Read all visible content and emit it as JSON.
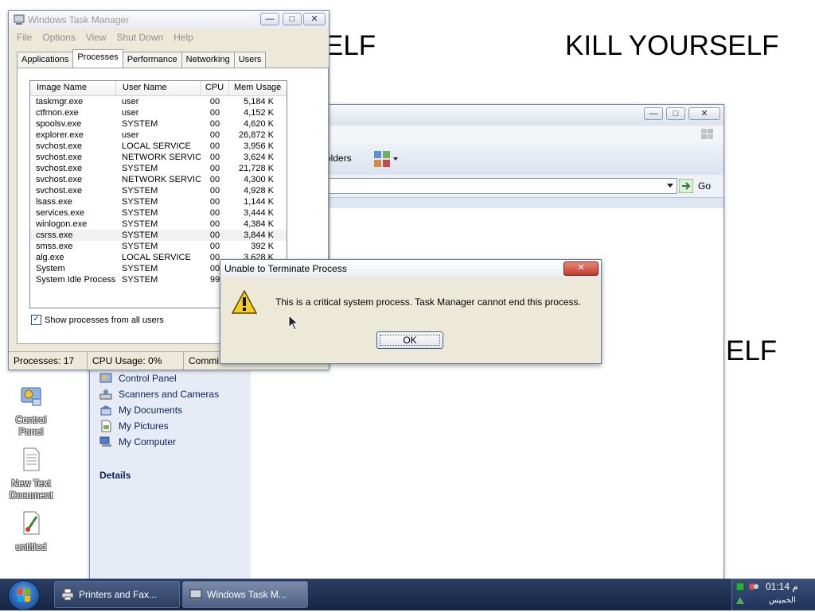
{
  "wallpaper": {
    "top_left_text": "ELF",
    "top_right_text": "KILL YOURSELF",
    "mid_right_text": "ELF"
  },
  "desktop_icons": [
    {
      "label_line1": "Control",
      "label_line2": "Panel",
      "icon": "control-panel-icon"
    },
    {
      "label_line1": "New Text",
      "label_line2": "Document",
      "icon": "text-document-icon"
    },
    {
      "label_line1": "untitled",
      "label_line2": "",
      "icon": "paint-file-icon"
    }
  ],
  "explorer": {
    "toolbar_folders_fragment": "olders",
    "go_label": "Go",
    "other_places": [
      {
        "label": "Control Panel",
        "icon": "control-panel-icon"
      },
      {
        "label": "Scanners and Cameras",
        "icon": "scanner-icon"
      },
      {
        "label": "My Documents",
        "icon": "my-documents-icon"
      },
      {
        "label": "My Pictures",
        "icon": "my-pictures-icon"
      },
      {
        "label": "My Computer",
        "icon": "my-computer-icon"
      }
    ],
    "details_label": "Details"
  },
  "taskmgr": {
    "title": "Windows Task Manager",
    "menu": [
      "File",
      "Options",
      "View",
      "Shut Down",
      "Help"
    ],
    "tabs": [
      "Applications",
      "Processes",
      "Performance",
      "Networking",
      "Users"
    ],
    "active_tab": "Processes",
    "columns": [
      "Image Name",
      "User Name",
      "CPU",
      "Mem Usage"
    ],
    "processes": [
      [
        "taskmgr.exe",
        "user",
        "00",
        "5,184 K"
      ],
      [
        "ctfmon.exe",
        "user",
        "00",
        "4,152 K"
      ],
      [
        "spoolsv.exe",
        "SYSTEM",
        "00",
        "4,620 K"
      ],
      [
        "explorer.exe",
        "user",
        "00",
        "26,872 K"
      ],
      [
        "svchost.exe",
        "LOCAL SERVICE",
        "00",
        "3,956 K"
      ],
      [
        "svchost.exe",
        "NETWORK SERVICE",
        "00",
        "3,624 K"
      ],
      [
        "svchost.exe",
        "SYSTEM",
        "00",
        "21,728 K"
      ],
      [
        "svchost.exe",
        "NETWORK SERVICE",
        "00",
        "4,300 K"
      ],
      [
        "svchost.exe",
        "SYSTEM",
        "00",
        "4,928 K"
      ],
      [
        "lsass.exe",
        "SYSTEM",
        "00",
        "1,144 K"
      ],
      [
        "services.exe",
        "SYSTEM",
        "00",
        "3,444 K"
      ],
      [
        "winlogon.exe",
        "SYSTEM",
        "00",
        "4,384 K"
      ],
      [
        "csrss.exe",
        "SYSTEM",
        "00",
        "3,844 K"
      ],
      [
        "smss.exe",
        "SYSTEM",
        "00",
        "392 K"
      ],
      [
        "alg.exe",
        "LOCAL SERVICE",
        "00",
        "3,628 K"
      ],
      [
        "System",
        "SYSTEM",
        "00",
        ""
      ],
      [
        "System Idle Process",
        "SYSTEM",
        "99",
        ""
      ]
    ],
    "show_all_label": "Show processes from all users",
    "show_all_checked": true,
    "status": {
      "processes": "Processes: 17",
      "cpu": "CPU Usage: 0%",
      "commit": "Commi"
    }
  },
  "dialog": {
    "title": "Unable to Terminate Process",
    "message": "This is a critical system process.  Task Manager cannot end this process.",
    "ok_label": "OK",
    "icon": "warning-icon"
  },
  "taskbar": {
    "buttons": [
      {
        "label": "Printers and Fax...",
        "icon": "printer-icon",
        "active": false
      },
      {
        "label": "Windows Task M...",
        "icon": "task-manager-icon",
        "active": true
      }
    ],
    "clock": "01:14 م",
    "day": "الخميس"
  }
}
